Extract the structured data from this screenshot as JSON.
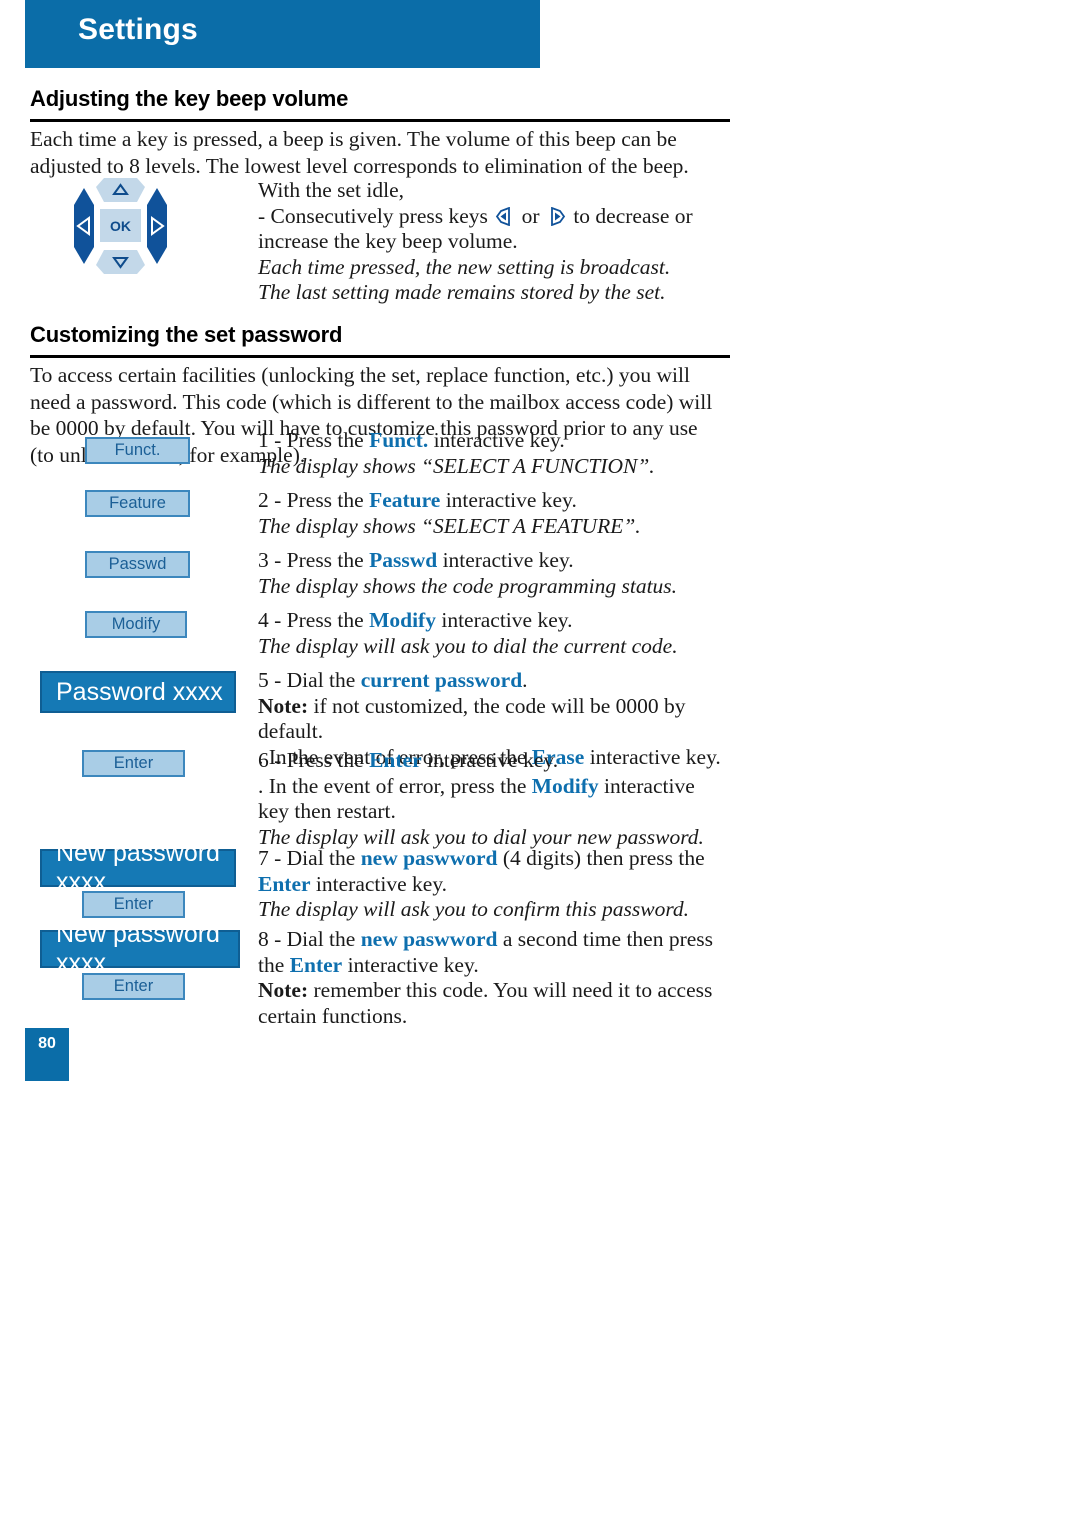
{
  "header": {
    "title": "Settings"
  },
  "sections": [
    {
      "id": "beep",
      "heading": "Adjusting the key beep volume",
      "intro": "Each time a key is pressed, a beep is given. The volume of this beep can be adjusted to 8 levels. The lowest level corresponds to elimination of the beep.",
      "nav_pad": {
        "center_label": "OK",
        "left_icon": "arrow-left-key-icon",
        "right_icon": "arrow-right-key-icon",
        "up_icon": "arrow-up-key-icon",
        "down_icon": "arrow-down-key-icon"
      },
      "instruction": {
        "line1": "With the set idle,",
        "line2_pre": "- Consecutively press keys",
        "line2_mid": "or",
        "line2_post": "to decrease or increase the key beep volume.",
        "italic1": "Each time pressed, the new setting is broadcast.",
        "italic2": "The last setting made remains stored by the set."
      }
    },
    {
      "id": "password",
      "heading": "Customizing the set password",
      "intro": "To access certain facilities (unlocking the set, replace function, etc.) you will need a password. This code (which is different to the mailbox access code) will be 0000 by default. You will have to customize this password prior to any use (to unlock the set, for example)."
    }
  ],
  "steps": [
    {
      "number": "1",
      "softkey_label": "Funct.",
      "line1_pre": "1 - Press the ",
      "line1_key": "Funct.",
      "line1_post": " interactive key.",
      "italic": "The display shows “SELECT A FUNCTION”."
    },
    {
      "number": "2",
      "softkey_label": "Feature",
      "line1_pre": "2 - Press the ",
      "line1_key": "Feature",
      "line1_post": " interactive key.",
      "italic": "The display shows “SELECT A FEATURE”."
    },
    {
      "number": "3",
      "softkey_label": "Passwd",
      "line1_pre": "3 - Press the ",
      "line1_key": "Passwd",
      "line1_post": " interactive key.",
      "italic": "The display shows the code programming status."
    },
    {
      "number": "4",
      "softkey_label": "Modify",
      "line1_pre": "4 - Press the ",
      "line1_key": "Modify",
      "line1_post": " interactive key.",
      "italic": "The display will ask you to dial the current code."
    }
  ],
  "step5": {
    "display_label": "Password xxxx",
    "line1_pre": "5 - Dial the ",
    "line1_key": "current password",
    "line1_post": ".",
    "line2_bold": "Note:",
    "line2_rest": " if not customized, the code will be 0000 by default.",
    "line3_pre": ". In the event of error, press the ",
    "line3_key": "Erase",
    "line3_post": " interactive key."
  },
  "step6": {
    "softkey_label": "Enter",
    "line1_pre": "6 - Press the ",
    "line1_key": "Enter",
    "line1_post": " interactive key.",
    "line2_pre": ". In the event of error, press the ",
    "line2_key": "Modify",
    "line2_post": " interactive key then restart.",
    "italic": "The display will ask you to dial your new password."
  },
  "step7": {
    "display_label": "New password xxxx",
    "softkey_label": "Enter",
    "line1_pre": "7 - Dial the ",
    "line1_key": "new paswword",
    "line1_mid": " (4 digits) then press the ",
    "line1_key2": "Enter",
    "line1_post": " interactive key.",
    "italic": "The display will ask you to confirm this password."
  },
  "step8": {
    "display_label": "New password xxxx",
    "softkey_label": "Enter",
    "line1_pre": "8 - Dial the ",
    "line1_key": "new paswword",
    "line1_mid": " a second time then press the ",
    "line1_key2": "Enter",
    "line1_post": " interactive key.",
    "line2_bold": "Note:",
    "line2_rest": " remember this code. You will need it to access certain functions."
  },
  "footer": {
    "page_number": "80"
  },
  "colors": {
    "brand_blue": "#0B6DA8",
    "display_blue": "#1579B5",
    "softkey_fill": "#A9CDE6",
    "softkey_border": "#3C87BD",
    "softkey_text": "#1B5F96",
    "keyword_blue": "#0E6FAE",
    "navpad_dark": "#10529A",
    "navpad_light": "#BFD6E8"
  }
}
